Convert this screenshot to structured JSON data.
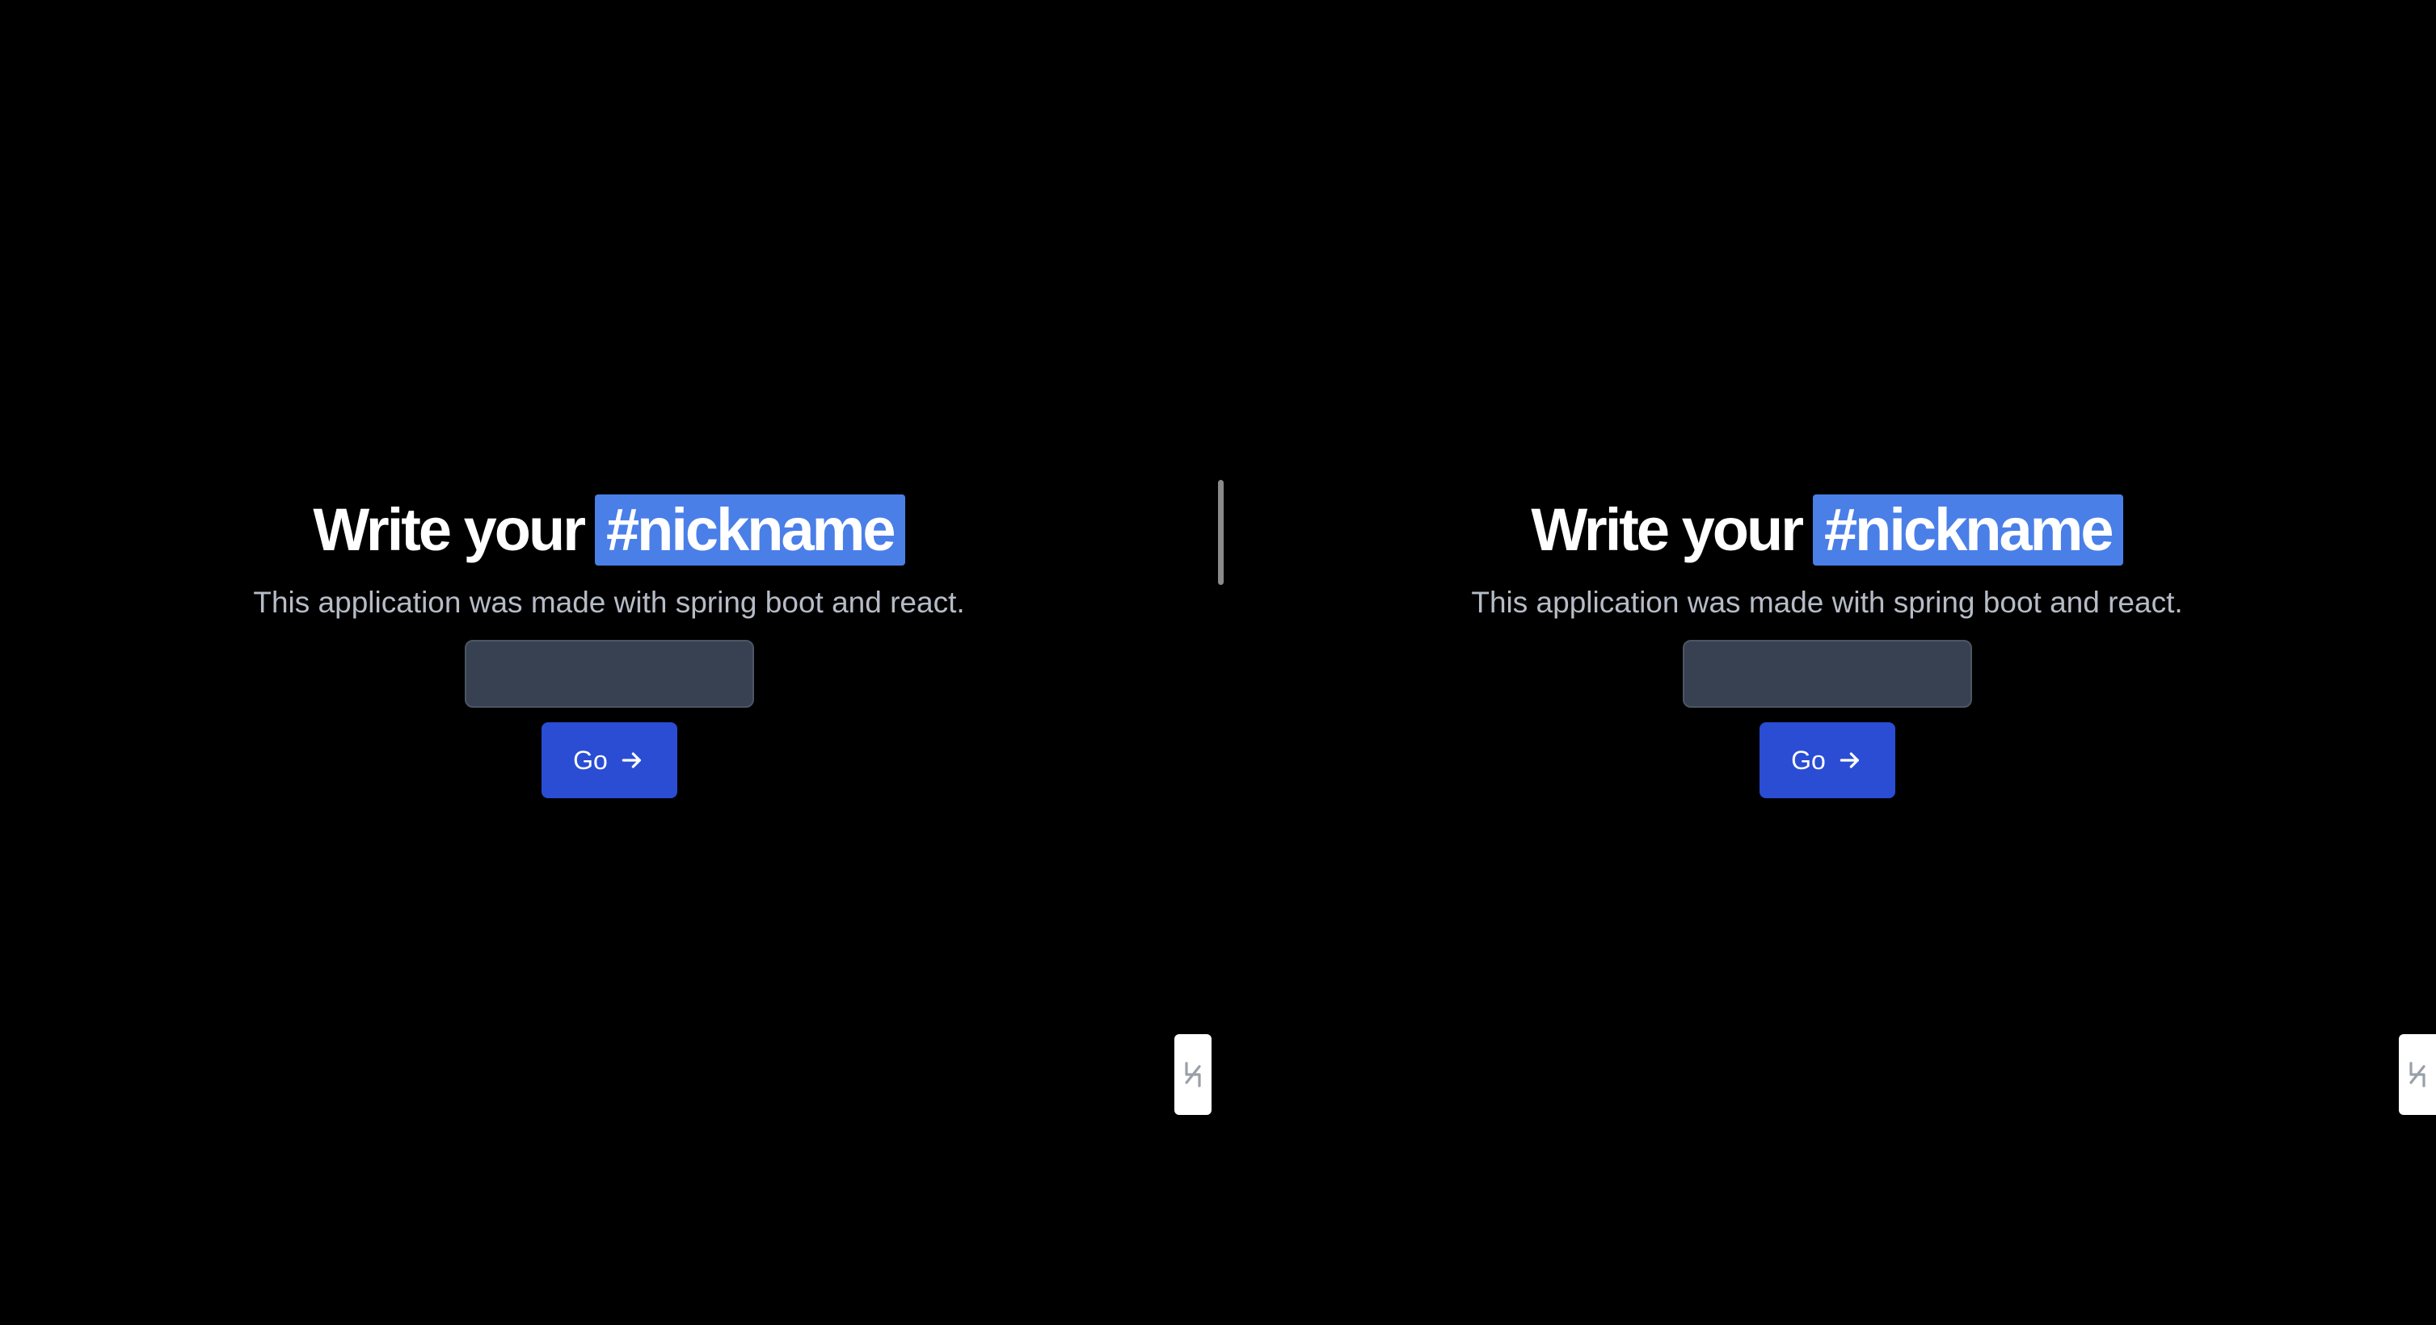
{
  "panes": [
    {
      "title_prefix": "Write your",
      "title_highlight": "#nickname",
      "subtitle": "This application was made with spring boot and react.",
      "nickname_input": {
        "value": "",
        "placeholder": ""
      },
      "go_button_label": "Go",
      "go_button_icon": "arrow-right-icon"
    },
    {
      "title_prefix": "Write your",
      "title_highlight": "#nickname",
      "subtitle": "This application was made with spring boot and react.",
      "nickname_input": {
        "value": "",
        "placeholder": ""
      },
      "go_button_label": "Go",
      "go_button_icon": "arrow-right-icon"
    }
  ],
  "side_tab_icon": "collapse-arrows-icon",
  "colors": {
    "background": "#000000",
    "highlight": "#4a7fe8",
    "button": "#2a4dd4",
    "input_background": "#374151",
    "subtitle_text": "#b6bcc6"
  }
}
